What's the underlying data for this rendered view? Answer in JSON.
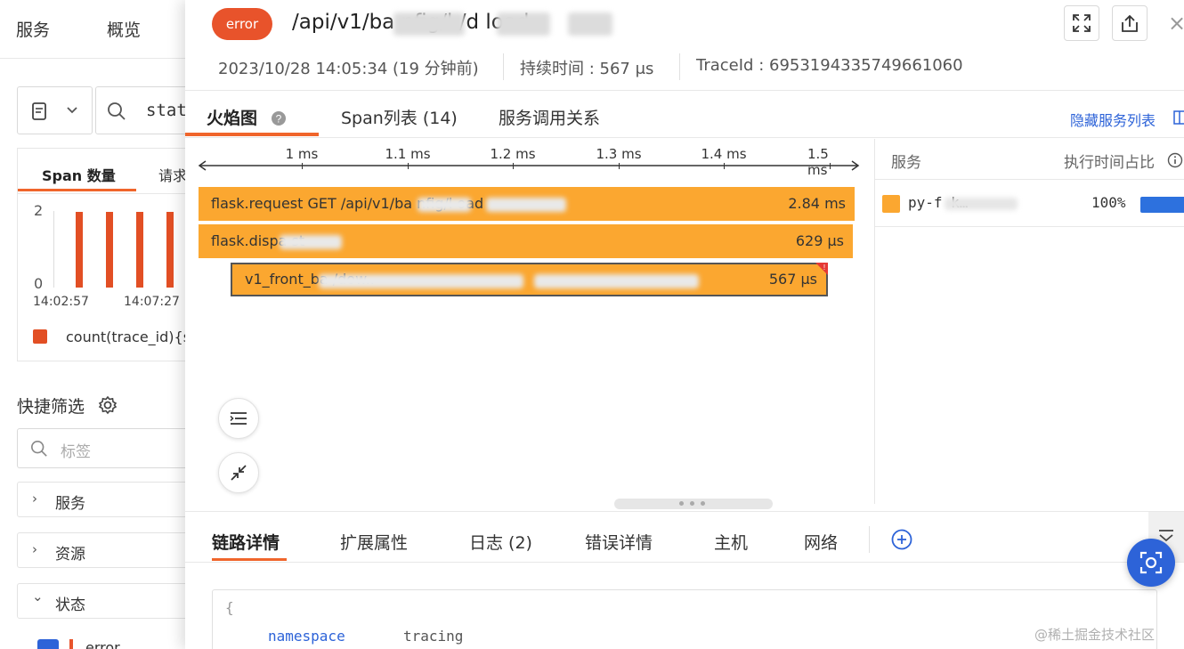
{
  "bg": {
    "nav": [
      "服务",
      "概览"
    ],
    "search_text": "stat",
    "card_tabs": [
      "Span 数量",
      "请求"
    ],
    "y_ticks": [
      "2",
      "0"
    ],
    "x_ticks": [
      "14:02:57",
      "14:07:27"
    ],
    "legend": "count(trace_id){st",
    "quick_filter_title": "快捷筛选",
    "tag_placeholder": "标签",
    "filters": [
      {
        "label": "服务",
        "chevron": "›"
      },
      {
        "label": "资源",
        "chevron": "›"
      },
      {
        "label": "状态",
        "chevron": "⌄"
      }
    ],
    "status_value": "error"
  },
  "drawer": {
    "status": "error",
    "title": "/api/v1/ba        nfig/l      /d      load",
    "timestamp": "2023/10/28 14:05:34 (19 分钟前)",
    "duration": "持续时间 : 567 μs",
    "trace_id": "TraceId : 6953194335749661060",
    "close": "×"
  },
  "top_tabs": [
    {
      "label": "火焰图",
      "active": true
    },
    {
      "label": "Span列表 (14)",
      "active": false
    },
    {
      "label": "服务调用关系",
      "active": false
    }
  ],
  "hide_service_list": "隐藏服务列表",
  "flame": {
    "ticks": [
      "1 ms",
      "1.1 ms",
      "1.2 ms",
      "1.3 ms",
      "1.4 ms",
      "1.5 ms"
    ],
    "bars": [
      {
        "name": "flask.request GET /api/v1/ba        nfig/l             oad",
        "duration": "2.84 ms"
      },
      {
        "name": "flask.dispa          st",
        "duration": "629 μs"
      },
      {
        "name": "v1_front_ba                                                 /dow..",
        "duration": "567 μs"
      }
    ]
  },
  "service_panel": {
    "col_service": "服务",
    "col_ratio": "执行时间占比",
    "row": {
      "name": "py-f          k…",
      "ratio": "100%",
      "color": "#fba730"
    }
  },
  "bottom_tabs": [
    {
      "label": "链路详情",
      "active": true
    },
    {
      "label": "扩展属性",
      "active": false
    },
    {
      "label": "日志 (2)",
      "active": false
    },
    {
      "label": "错误详情",
      "active": false
    },
    {
      "label": "主机",
      "active": false
    },
    {
      "label": "网络",
      "active": false
    }
  ],
  "code": {
    "brace": "{",
    "key": "namespace",
    "value": "tracing"
  },
  "watermark": "@稀土掘金技术社区",
  "colors": {
    "accent": "#f0652b",
    "flame_bar": "#fba730",
    "error": "#e8532b",
    "primary": "#2d63d8"
  }
}
